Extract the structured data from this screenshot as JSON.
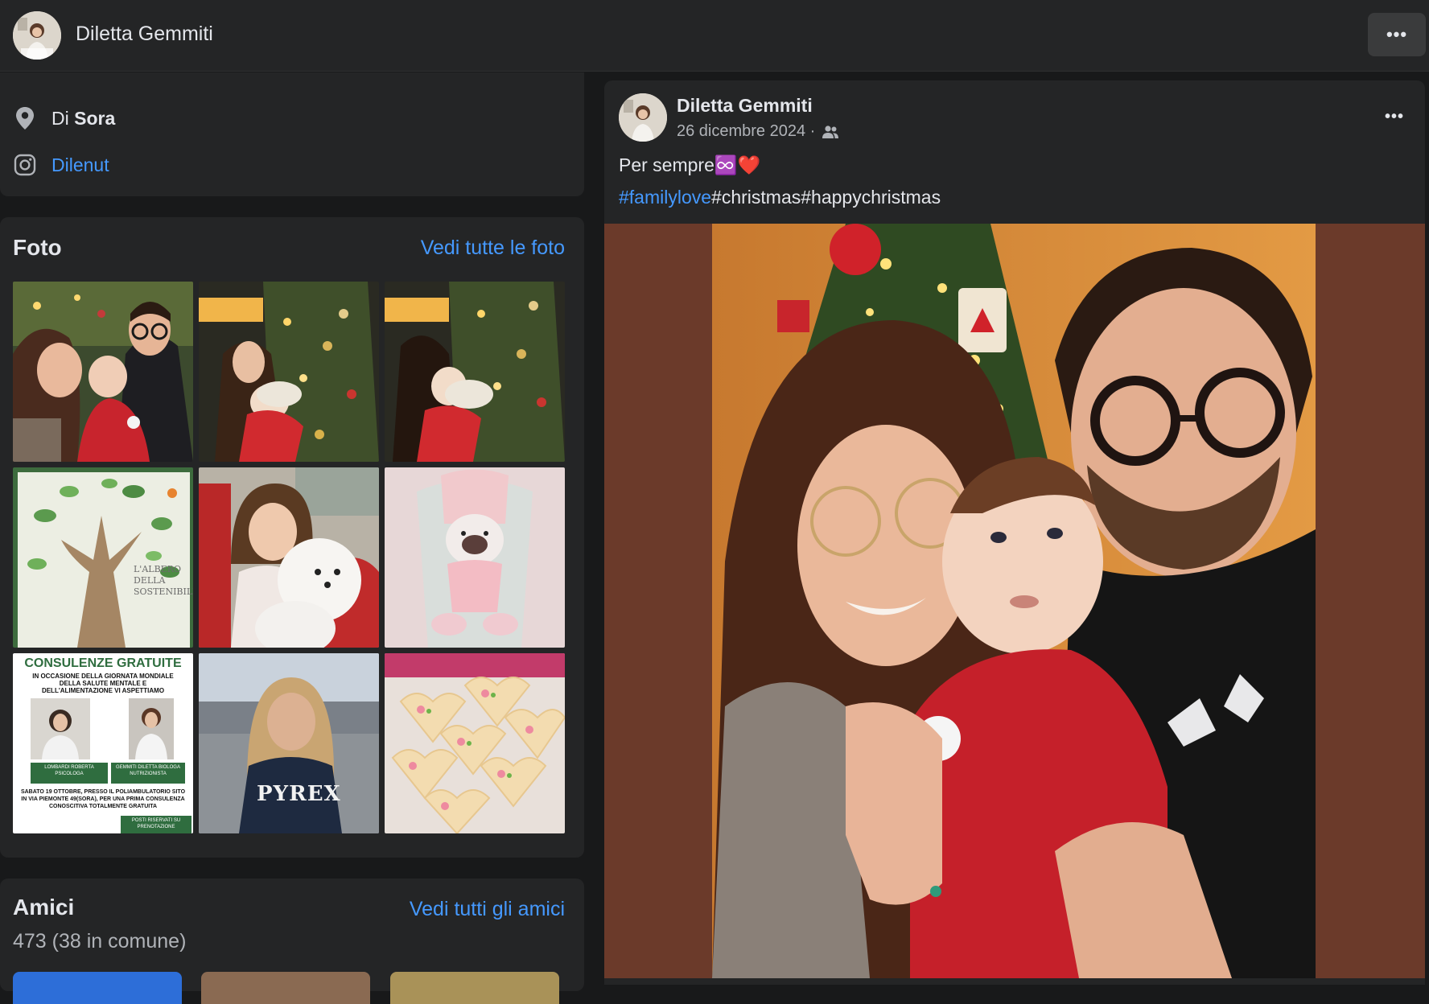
{
  "header": {
    "profile_name": "Diletta Gemmiti",
    "more_label": "•••"
  },
  "intro": {
    "from_prefix": "Di",
    "from_place": "Sora",
    "instagram": "Dilenut"
  },
  "photos": {
    "title": "Foto",
    "see_all": "Vedi tutte le foto",
    "tiles": [
      {
        "alt": "family christmas selfie"
      },
      {
        "alt": "woman with baby at christmas tree"
      },
      {
        "alt": "woman kissing baby at christmas tree"
      },
      {
        "alt": "tree drawing",
        "caption": "L'ALBERO DELLA SOSTENIBILITÀ"
      },
      {
        "alt": "girl with white dog"
      },
      {
        "alt": "pink bunny decoration"
      },
      {
        "alt": "consultation flyer",
        "heading": "CONSULENZE GRATUITE",
        "sub": "IN OCCASIONE DELLA GIORNATA MONDIALE DELLA SALUTE MENTALE E DELL'ALIMENTAZIONE VI ASPETTIAMO",
        "left_name": "LOMBARDI ROBERTA PSICOLOGA",
        "right_name": "GEMMITI DILETTA BIOLOGA NUTRIZIONISTA",
        "footer": "SABATO 19 OTTOBRE, PRESSO IL POLIAMBULATORIO SITO IN VIA PIEMONTE 49(SORA), PER UNA PRIMA CONSULENZA CONOSCITIVA TOTALMENTE GRATUITA",
        "badge": "POSTI RISERVATI SU PRENOTAZIONE"
      },
      {
        "alt": "woman in pyrex sweatshirt",
        "shirt": "PYREX"
      },
      {
        "alt": "decorated cookies"
      }
    ]
  },
  "friends": {
    "title": "Amici",
    "see_all": "Vedi tutti gli amici",
    "count": "473 (38 in comune)"
  },
  "post": {
    "author": "Diletta Gemmiti",
    "date": "26 dicembre 2024 ·",
    "text": "Per sempre♾️❤️",
    "tag_link": "#familylove",
    "tags_rest": "#christmas#happychristmas",
    "more_label": "•••"
  },
  "colors": {
    "background": "#18191a",
    "card": "#242526",
    "link": "#4599ff",
    "text": "#e4e6eb",
    "muted": "#b0b3b8"
  }
}
